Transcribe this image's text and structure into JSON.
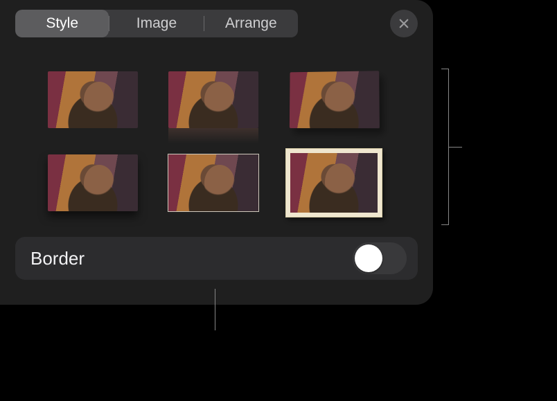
{
  "tabs": {
    "style": "Style",
    "image": "Image",
    "arrange": "Arrange",
    "active": "style"
  },
  "styles": [
    {
      "id": "plain"
    },
    {
      "id": "reflection"
    },
    {
      "id": "tilt-shadow"
    },
    {
      "id": "drop-shadow"
    },
    {
      "id": "thin-line"
    },
    {
      "id": "paper-frame"
    }
  ],
  "border": {
    "label": "Border",
    "on": false
  },
  "icons": {
    "close": "close-icon"
  }
}
